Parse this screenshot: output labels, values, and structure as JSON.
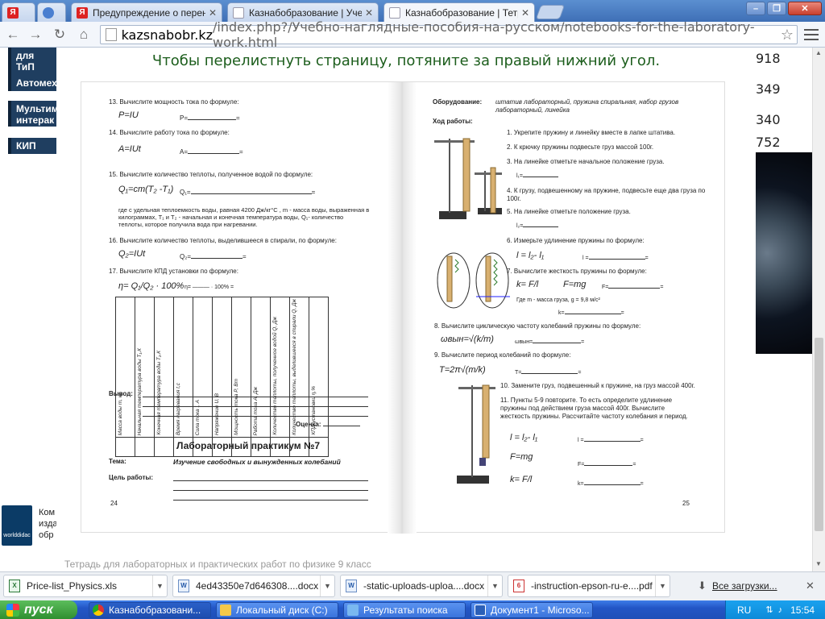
{
  "browser": {
    "tabs": [
      {
        "title": "Я",
        "favicon": "yandex-icon"
      },
      {
        "title": "",
        "favicon": "globe-icon"
      },
      {
        "title": "Предупреждение о перена",
        "favicon": "yandex-icon"
      },
      {
        "title": "Казнабобразование | Учеб",
        "favicon": "doc-icon"
      },
      {
        "title": "Казнабобразование | Тетр",
        "favicon": "doc-icon"
      }
    ],
    "url_host": "kazsnabobr.kz",
    "url_path": "/index.php?/Учебно-наглядные-пособия-на-русском/notebooks-for-the-laboratory-work.html"
  },
  "site": {
    "left_menu": [
      "для ТиП",
      "Автомех",
      "Мультим интерак",
      "КИП"
    ],
    "right_numbers": [
      "918",
      "349",
      "340",
      "752"
    ],
    "ad_logo": "worlddidac",
    "ad_text": "Ком изда обр",
    "hint": "Чтобы перелистнуть страницу, потяните за правый нижний угол.",
    "footer_caption": "Тетрадь для лабораторных и практических работ по физике 9 класс"
  },
  "left_page": {
    "q13": "13. Вычислите мощность тока по формуле:",
    "f13": "P=IU",
    "f13b": "P=",
    "q14": "14. Вычислите работу тока по формуле:",
    "f14": "A=IUt",
    "f14b": "A=",
    "q15": "15. Вычислите количество теплоты, полученное водой по формуле:",
    "f15": "Q₁=cm(T₂ -T₁)",
    "f15b": "Q₁=",
    "note15": "где c удельная теплоемкость воды, равная 4200 Дж/кг°С , m - масса воды, выраженная в килограммах, T₁ и T₂ - начальная и конечная температура воды, Q₁- количество теплоты, которое получила вода при нагревании.",
    "q16": "16. Вычислите количество теплоты, выделившееся в спирали, по формуле:",
    "f16": "Q₂=IUt",
    "f16b": "Q₂=",
    "q17": "17. Вычислите КПД установки по формуле:",
    "f17": "η= Q₁/Q₂ · 100%",
    "f17b": "η= ——— · 100% =",
    "table_headers": [
      "Масса воды m, кг",
      "Начальная температура воды T₁,К",
      "Конечная температура воды T₂,К",
      "Время нагревания t,c",
      "Сила тока I, A",
      "Напряжение U, B",
      "Мощность тока P, Вт",
      "Работа тока A, Дж",
      "Количество теплоты, полученное водой Q, Дж",
      "Количество теплоты, выделившееся в спирали Q, Дж",
      "КПД установки η,%"
    ],
    "conclusion": "Вывод:",
    "grade": "Оценка:",
    "practicum": "Лабораторный практикум №7",
    "topic_label": "Тема:",
    "topic": "Изучение свободных и вынужденных колебаний",
    "goal": "Цель работы:",
    "page_no": "24"
  },
  "right_page": {
    "equipment_label": "Оборудование:",
    "equipment": "штатив лабораторный, пружина спиральная, набор грузов лабораторный, линейка",
    "progress": "Ход работы:",
    "steps": [
      "1. Укрепите пружину и линейку вместе в лапке штатива.",
      "2. К крючку пружины подвесьте груз массой 100г.",
      "3. На линейке отметьте начальное положение груза.",
      "l₁=",
      "4. К грузу, подвешенному на пружине, подвесьте еще два груза по 100г.",
      "5. На линейке отметьте положение груза.",
      "l₂=",
      "6. Измерьте удлинение пружины по формуле:",
      "l = l₂- l₁",
      "l =",
      "7. Вычислите жесткость пружины по формуле:",
      "k= F/l",
      "F=mg",
      "F=",
      "Где m - масса груза, g = 9,8 м/с²",
      "k=",
      "8. Вычислите циклическую частоту колебаний пружины по формуле:",
      "ωвын=√(k/m)",
      "ωвын=",
      "9. Вычислите период колебаний по формуле:",
      "T=2π√(m/k)",
      "T=",
      "10. Замените груз, подвешенный к пружине, на груз массой 400г.",
      "11. Пункты 5-9 повторите. То есть определите удлинение пружины под действием груза массой 400г. Вычислите жесткость пружины. Рассчитайте частоту колебания и период.",
      "l = l₂- l₁",
      "l =",
      "F=mg",
      "F=",
      "k= F/l",
      "k="
    ],
    "page_no": "25"
  },
  "downloads": [
    {
      "name": "Price-list_Physics.xls",
      "type": "xls"
    },
    {
      "name": "4ed43350e7d646308....docx",
      "type": "docx"
    },
    {
      "name": "-static-uploads-uploa....docx",
      "type": "docx"
    },
    {
      "name": "-instruction-epson-ru-e....pdf",
      "type": "pdf"
    }
  ],
  "all_downloads": "Все загрузки...",
  "taskbar": {
    "start": "пуск",
    "items": [
      "Казнабобразовани...",
      "Локальный диск (C:)",
      "Результаты поиска",
      "Документ1 - Microso..."
    ],
    "lang": "RU",
    "clock": "15:54"
  },
  "colors": {
    "hint": "#1d5e1d",
    "menu_bg": "#1f3e60",
    "taskbar": "#2356c6",
    "start": "#2f8f2f"
  }
}
